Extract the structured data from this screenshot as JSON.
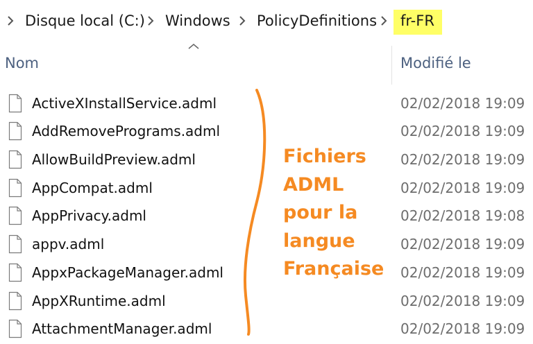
{
  "breadcrumb": {
    "items": [
      "Disque local (C:)",
      "Windows",
      "PolicyDefinitions"
    ],
    "current": "fr-FR",
    "highlight_color": "#ffff66"
  },
  "columns": {
    "name": "Nom",
    "modified": "Modifié le",
    "sort": "ascending"
  },
  "files": [
    {
      "name": "ActiveXInstallService.adml",
      "modified": "02/02/2018 19:09"
    },
    {
      "name": "AddRemovePrograms.adml",
      "modified": "02/02/2018 19:09"
    },
    {
      "name": "AllowBuildPreview.adml",
      "modified": "02/02/2018 19:09"
    },
    {
      "name": "AppCompat.adml",
      "modified": "02/02/2018 19:09"
    },
    {
      "name": "AppPrivacy.adml",
      "modified": "02/02/2018 19:08"
    },
    {
      "name": "appv.adml",
      "modified": "02/02/2018 19:09"
    },
    {
      "name": "AppxPackageManager.adml",
      "modified": "02/02/2018 19:09"
    },
    {
      "name": "AppXRuntime.adml",
      "modified": "02/02/2018 19:09"
    },
    {
      "name": "AttachmentManager.adml",
      "modified": "02/02/2018 19:09"
    }
  ],
  "annotation": {
    "lines": [
      "Fichiers",
      "ADML",
      "pour la",
      "langue",
      "Française"
    ],
    "color": "#f58a22"
  },
  "icons": {
    "breadcrumb_separator": "chevron-right-icon",
    "file": "document-icon",
    "sort": "sort-up-icon"
  }
}
